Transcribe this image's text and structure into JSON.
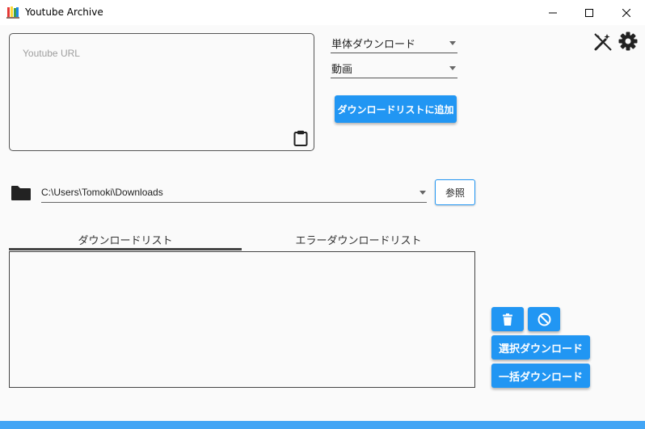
{
  "window": {
    "title": "Youtube Archive",
    "minimize_icon": "minimize-icon",
    "maximize_icon": "maximize-icon",
    "close_icon": "close-icon"
  },
  "toolbar": {
    "theme_icon": "magic-wand-off-icon",
    "settings_icon": "gear-icon"
  },
  "url_input": {
    "placeholder": "Youtube URL",
    "value": "",
    "paste_icon": "clipboard-icon"
  },
  "download_mode": {
    "selected": "単体ダウンロード"
  },
  "media_type": {
    "selected": "動画"
  },
  "add_button": {
    "label": "ダウンロードリストに追加"
  },
  "save_path": {
    "value": "C:\\Users\\Tomoki\\Downloads",
    "folder_icon": "folder-icon",
    "browse_label": "参照"
  },
  "tabs": [
    {
      "label": "ダウンロードリスト",
      "active": true
    },
    {
      "label": "エラーダウンロードリスト",
      "active": false
    }
  ],
  "download_list": {
    "items": []
  },
  "actions": {
    "delete_icon": "trash-icon",
    "cancel_icon": "block-icon",
    "download_selected_label": "選択ダウンロード",
    "download_all_label": "一括ダウンロード"
  },
  "colors": {
    "accent": "#2196f3",
    "background": "#fafafa",
    "bottom_bar": "#42a5f5"
  }
}
